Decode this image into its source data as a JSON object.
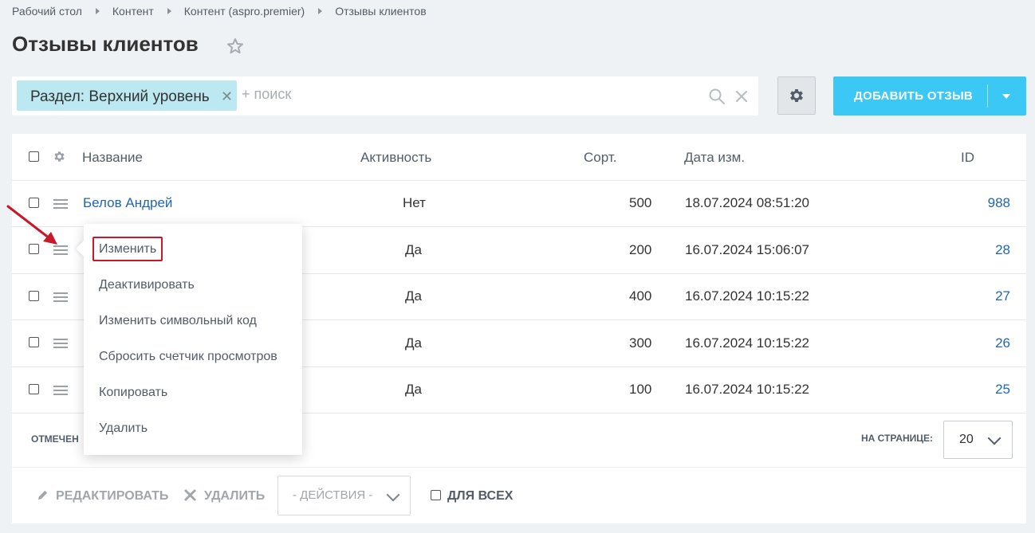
{
  "breadcrumb": [
    "Рабочий стол",
    "Контент",
    "Контент (aspro.premier)",
    "Отзывы клиентов"
  ],
  "page": {
    "title": "Отзывы клиентов"
  },
  "filter": {
    "chip_label": "Раздел: Верхний уровень",
    "search_placeholder": "+ поиск"
  },
  "toolbar": {
    "add_label": "ДОБАВИТЬ ОТЗЫВ"
  },
  "table": {
    "headers": {
      "name": "Название",
      "active": "Активность",
      "sort": "Сорт.",
      "date": "Дата изм.",
      "id": "ID"
    },
    "rows": [
      {
        "name": "Белов Андрей",
        "active": "Нет",
        "sort": "500",
        "date": "18.07.2024 08:51:20",
        "id": "988"
      },
      {
        "name": "",
        "active": "Да",
        "sort": "200",
        "date": "16.07.2024 15:06:07",
        "id": "28"
      },
      {
        "name": "",
        "active": "Да",
        "sort": "400",
        "date": "16.07.2024 10:15:22",
        "id": "27"
      },
      {
        "name": "",
        "active": "Да",
        "sort": "300",
        "date": "16.07.2024 10:15:22",
        "id": "26"
      },
      {
        "name": "",
        "active": "Да",
        "sort": "100",
        "date": "16.07.2024 10:15:22",
        "id": "25"
      }
    ],
    "footer_marked": "ОТМЕЧЕН",
    "per_page_label": "НА СТРАНИЦЕ:",
    "per_page_value": "20"
  },
  "context_menu": {
    "items": [
      "Изменить",
      "Деактивировать",
      "Изменить символьный код",
      "Сбросить счетчик просмотров",
      "Копировать",
      "Удалить"
    ]
  },
  "action_bar": {
    "edit_label": "РЕДАКТИРОВАТЬ",
    "delete_label": "УДАЛИТЬ",
    "actions_placeholder": "- ДЕЙСТВИЯ -",
    "for_all_label": "ДЛЯ ВСЕХ"
  },
  "colors": {
    "accent": "#3bc8f5",
    "link": "#2067b0",
    "chip": "#bce8f1",
    "highlight": "#c8192a"
  }
}
